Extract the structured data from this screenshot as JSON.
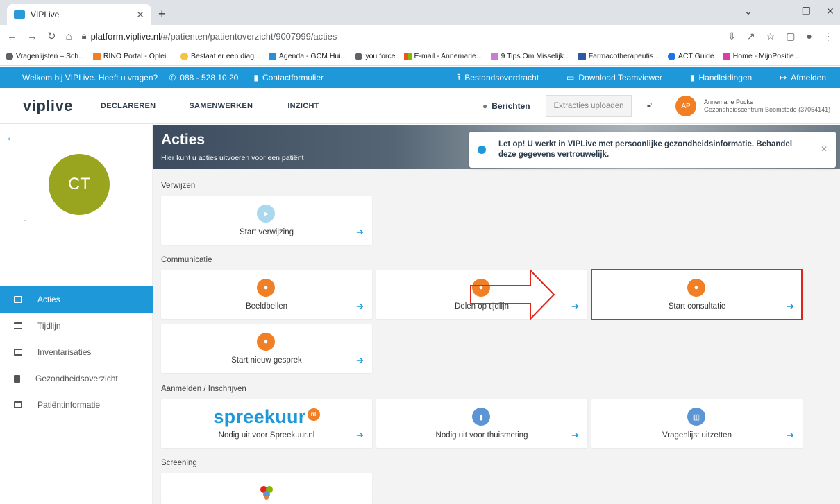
{
  "browser": {
    "tab_title": "VIPLive",
    "url_host": "platform.viplive.nl",
    "url_path": "/#/patienten/patientoverzicht/9007999/acties",
    "bookmarks": [
      "Vragenlijsten – Sch...",
      "RINO Portal - Oplei...",
      "Bestaat er een diag...",
      "Agenda - GCM Hui...",
      "you force",
      "E-mail - Annemarie...",
      "9 Tips Om Misselijk...",
      "Farmacotherapeutis...",
      "ACT Guide",
      "Home - MijnPositie..."
    ]
  },
  "topbar": {
    "welcome": "Welkom bij VIPLive. Heeft u vragen?",
    "phone": "088 - 528 10 20",
    "contact": "Contactformulier",
    "transfer": "Bestandsoverdracht",
    "teamviewer": "Download Teamviewer",
    "manuals": "Handleidingen",
    "logout": "Afmelden"
  },
  "nav": {
    "logo": "viplive",
    "menu": [
      "DECLAREREN",
      "SAMENWERKEN",
      "INZICHT"
    ],
    "messages": "Berichten",
    "upload": "Extracties uploaden",
    "user_initials": "AP",
    "user_name": "Annemarie Pucks",
    "user_org": "Gezondheidscentrum Boomstede (37054141)"
  },
  "sidebar": {
    "patient_initials": "CT",
    "dash": "-",
    "items": [
      "Acties",
      "Tijdlijn",
      "Inventarisaties",
      "Gezondheidsoverzicht",
      "Patiëntinformatie"
    ]
  },
  "main": {
    "title": "Acties",
    "subtitle": "Hier kunt u acties uitvoeren voor een patiënt",
    "notice": "Let op! U werkt in VIPLive met persoonlijke gezondheidsinformatie. Behandel deze gegevens vertrouwelijk.",
    "sections": {
      "verwijzen": "Verwijzen",
      "communicatie": "Communicatie",
      "aanmelden": "Aanmelden / Inschrijven",
      "screening": "Screening"
    },
    "cards": {
      "start_verwijzing": "Start verwijzing",
      "beeldbellen": "Beeldbellen",
      "delen_tijdlijn": "Delen op tijdlijn",
      "start_consultatie": "Start consultatie",
      "start_gesprek": "Start nieuw gesprek",
      "spreekuur_logo": "spreekuur",
      "spreekuur_badge": "nl",
      "spreekuur": "Nodig uit voor Spreekuur.nl",
      "thuismeting": "Nodig uit voor thuismeting",
      "vragenlijst": "Vragenlijst uitzetten"
    }
  },
  "colors": {
    "primary_blue": "#1e98d8",
    "orange": "#f07f25",
    "patient_avatar": "#9aa51f",
    "highlight_red": "#e2231a"
  }
}
